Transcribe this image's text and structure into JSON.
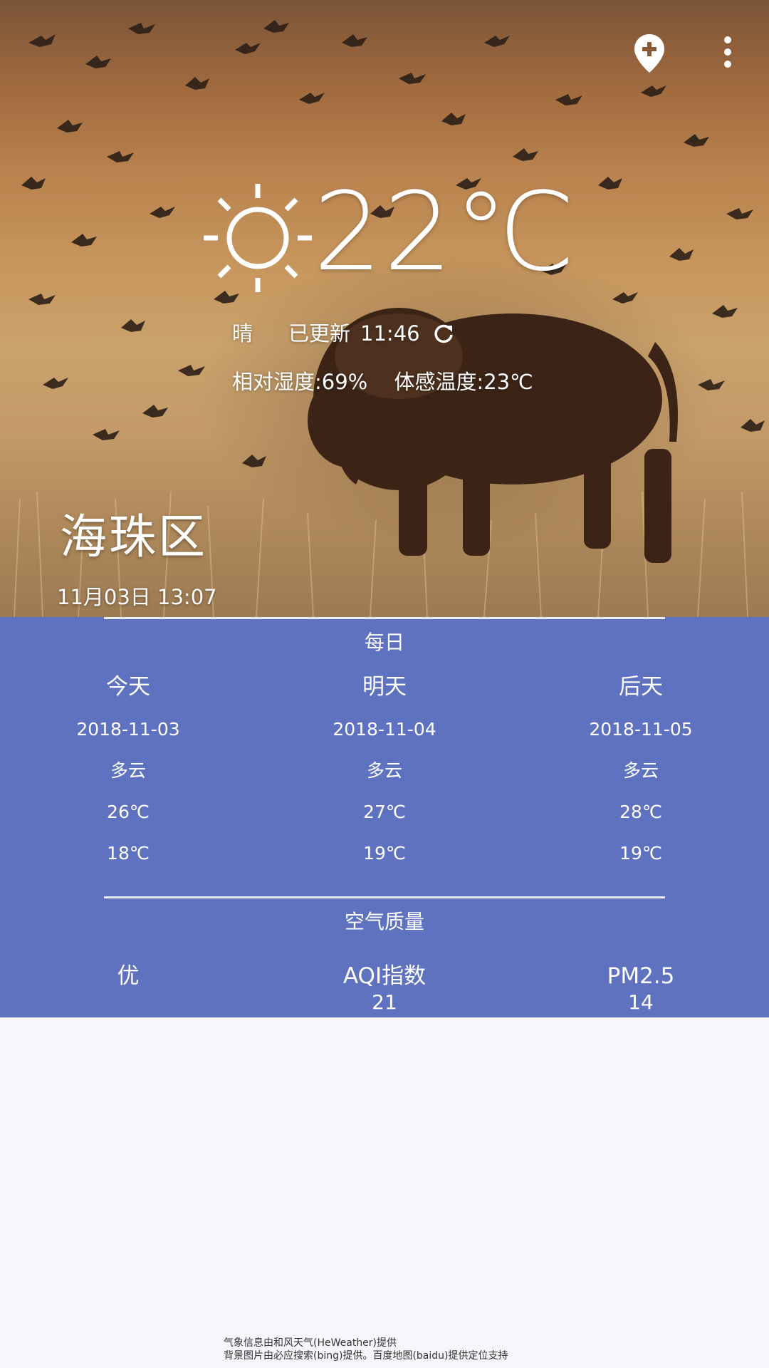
{
  "header": {
    "add_location_icon": "add-location-icon",
    "more_icon": "more-vert-icon"
  },
  "current": {
    "weather_icon": "sun-icon",
    "temperature": "22℃",
    "condition": "晴",
    "updated_label": "已更新",
    "updated_time": "11:46",
    "refresh_icon": "refresh-icon",
    "humidity": "相对湿度:69%",
    "feels_like": "体感温度:23℃",
    "city": "海珠区",
    "datetime": "11月03日 13:07"
  },
  "daily": {
    "title": "每日",
    "days": [
      {
        "label": "今天",
        "date": "2018-11-03",
        "condition": "多云",
        "max": "26℃",
        "min": "18℃"
      },
      {
        "label": "明天",
        "date": "2018-11-04",
        "condition": "多云",
        "max": "27℃",
        "min": "19℃"
      },
      {
        "label": "后天",
        "date": "2018-11-05",
        "condition": "多云",
        "max": "28℃",
        "min": "19℃"
      }
    ]
  },
  "air": {
    "title": "空气质量",
    "quality": "优",
    "aqi_label": "AQI指数",
    "aqi_value": "21",
    "pm25_label": "PM2.5",
    "pm25_value": "14"
  },
  "footer": {
    "line1": "气象信息由和风天气(HeWeather)提供",
    "line2": "背景图片由必应搜索(bing)提供。百度地图(baidu)提供定位支持"
  },
  "colors": {
    "panel": "#5f72c0",
    "text": "#ffffff",
    "page_background": "#f7f6fb"
  }
}
